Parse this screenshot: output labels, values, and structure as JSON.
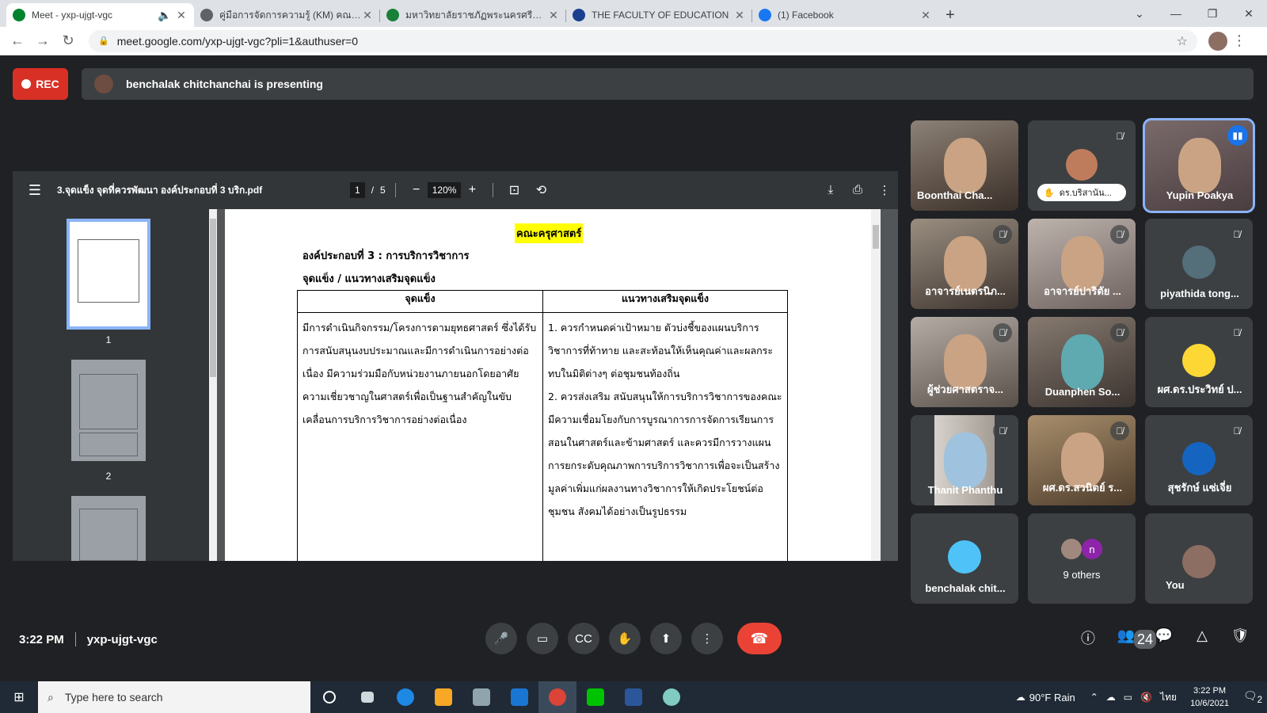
{
  "browser": {
    "tabs": [
      {
        "title": "Meet - yxp-ujgt-vgc",
        "favicon_color": "#00832d",
        "active": true
      },
      {
        "title": "คู่มือการจัดการความรู้ (KM) คณะครุศาสตร์",
        "favicon_color": "#5f6368",
        "active": false
      },
      {
        "title": "มหาวิทยาลัยราชภัฏพระนครศรีอยุธยา",
        "favicon_color": "#188038",
        "active": false
      },
      {
        "title": "THE FACULTY OF EDUCATION",
        "favicon_color": "#1a3f8f",
        "active": false
      },
      {
        "title": "(1) Facebook",
        "favicon_color": "#1877f2",
        "active": false
      }
    ],
    "url": "meet.google.com/yxp-ujgt-vgc?pli=1&authuser=0"
  },
  "meet": {
    "rec_label": "REC",
    "presenting_text": "benchalak chitchanchai is presenting",
    "meeting_time": "3:22 PM",
    "meeting_code": "yxp-ujgt-vgc",
    "participant_count": "24",
    "accent": "#8ab4f8",
    "end_color": "#ea4335"
  },
  "pdf": {
    "filename": "3.จุดแข็ง จุดที่ควรพัฒนา องค์ประกอบที่ 3 บริก.pdf",
    "current_page": "1",
    "page_sep": "/",
    "total_pages": "5",
    "zoom": "120%",
    "thumbnails": [
      "1",
      "2"
    ],
    "content": {
      "faculty": "คณะครุศาสตร์",
      "component": "องค์ประกอบที่ 3 : การบริการวิชาการ",
      "subtitle": "จุดแข็ง / แนวทางเสริมจุดแข็ง",
      "col1_header": "จุดแข็ง",
      "col2_header": "แนวทางเสริมจุดแข็ง",
      "strength": "มีการดำเนินกิจกรรม/โครงการตามยุทธศาสตร์ ซึ่งได้รับการสนับสนุนงบประมาณและมีการดำเนินการอย่างต่อเนื่อง มีความร่วมมือกับหน่วยงานภายนอกโดยอาศัยความเชี่ยวชาญในศาสตร์เพื่อเป็นฐานสำคัญในขับเคลื่อนการบริการวิชาการอย่างต่อเนื่อง",
      "guideline_1": "1. ควรกำหนดค่าเป้าหมาย ตัวบ่งชี้ของแผนบริการวิชาการที่ท้าทาย และสะท้อนให้เห็นคุณค่าและผลกระทบในมิติต่างๆ ต่อชุมชนท้องถิ่น",
      "guideline_2": "2. ควรส่งเสริม สนับสนุนให้การบริการวิชาการของคณะมีความเชื่อมโยงกับการบูรณาการการจัดการเรียนการสอนในศาสตร์และข้ามศาสตร์ และควรมีการวางแผนการยกระดับคุณภาพการบริการวิชาการเพื่อจะเป็นสร้างมูลค่าเพิ่มแก่ผลงานทางวิชาการให้เกิดประโยชน์ต่อชุมชน สังคมได้อย่างเป็นรูปธรรม"
    }
  },
  "participants": [
    {
      "name": "Boonthai Cha...",
      "type": "video",
      "muted": false
    },
    {
      "name": "ดร.บริสานัน...",
      "type": "pill",
      "muted": true
    },
    {
      "name": "Yupin Poakya",
      "type": "video",
      "muted": false,
      "speaking": true
    },
    {
      "name": "อาจารย์เนตรนิภ...",
      "type": "video",
      "muted": true
    },
    {
      "name": "อาจารย์ปาริตัย ...",
      "type": "video",
      "muted": true
    },
    {
      "name": "piyathida tong...",
      "type": "avatar",
      "muted": true
    },
    {
      "name": "ผู้ช่วยศาสตราจ...",
      "type": "video",
      "muted": true
    },
    {
      "name": "Duanphen So...",
      "type": "video",
      "muted": true
    },
    {
      "name": "ผศ.ดร.ประวิทย์ ป...",
      "type": "avatar",
      "muted": true
    },
    {
      "name": "Thanit Phanthu",
      "type": "video",
      "muted": true
    },
    {
      "name": "ผศ.ดร.สวนิตย์ ร...",
      "type": "video",
      "muted": true
    },
    {
      "name": "สุชรักษ์ แซ่เจี่ย",
      "type": "avatar",
      "muted": true
    },
    {
      "name": "benchalak chit...",
      "type": "avatar",
      "muted": false
    },
    {
      "name": "9 others",
      "type": "others",
      "muted": false
    },
    {
      "name": "You",
      "type": "avatar",
      "muted": false
    }
  ],
  "others_initial": "n",
  "taskbar": {
    "search_placeholder": "Type here to search",
    "weather": "90°F  Rain",
    "language": "ไทย",
    "time": "3:22 PM",
    "date": "10/6/2021",
    "notification_count": "2"
  }
}
